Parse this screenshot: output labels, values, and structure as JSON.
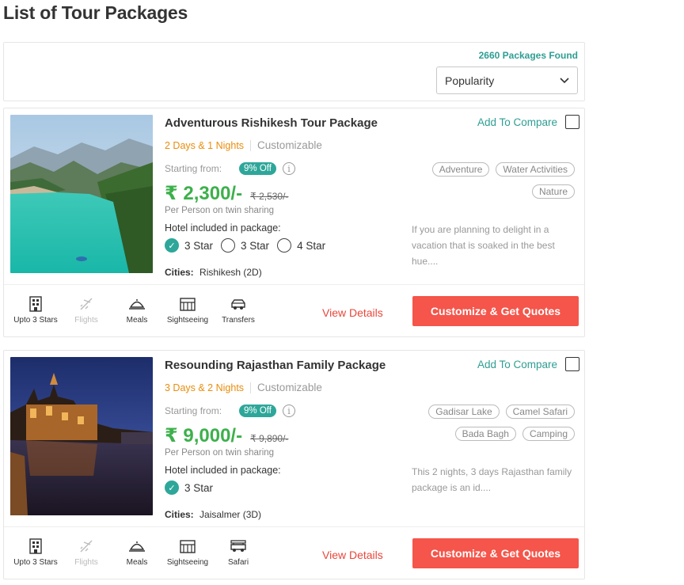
{
  "page": {
    "title": "List of Tour Packages"
  },
  "sortbar": {
    "found": "2660 Packages Found",
    "sort_selected": "Popularity"
  },
  "packages": [
    {
      "title": "Adventurous Rishikesh Tour Package",
      "compare_label": "Add To Compare",
      "duration": "2 Days & 1 Nights",
      "customizable": "Customizable",
      "starting_from": "Starting from:",
      "discount": "9% Off",
      "price": "₹ 2,300/-",
      "old_price": "₹ 2,530/-",
      "per_person": "Per Person on twin sharing",
      "hotel_label": "Hotel included in package:",
      "hotel_options": [
        {
          "label": "3 Star",
          "checked": true
        },
        {
          "label": "3 Star",
          "checked": false
        },
        {
          "label": "4 Star",
          "checked": false
        }
      ],
      "cities_label": "Cities:",
      "cities": "Rishikesh (2D)",
      "tags": [
        "Adventure",
        "Water Activities",
        "Nature"
      ],
      "description": "If you are planning to delight in a vacation that is soaked in the best hue....",
      "features": [
        {
          "label": "Upto 3 Stars",
          "icon": "hotel-icon",
          "enabled": true
        },
        {
          "label": "Flights",
          "icon": "flight-icon",
          "enabled": false
        },
        {
          "label": "Meals",
          "icon": "meal-cloche-icon",
          "enabled": true
        },
        {
          "label": "Sightseeing",
          "icon": "sightseeing-icon",
          "enabled": true
        },
        {
          "label": "Transfers",
          "icon": "car-icon",
          "enabled": true
        }
      ],
      "view_details": "View Details",
      "cta": "Customize & Get Quotes"
    },
    {
      "title": "Resounding Rajasthan Family Package",
      "compare_label": "Add To Compare",
      "duration": "3 Days & 2 Nights",
      "customizable": "Customizable",
      "starting_from": "Starting from:",
      "discount": "9% Off",
      "price": "₹ 9,000/-",
      "old_price": "₹ 9,890/-",
      "per_person": "Per Person on twin sharing",
      "hotel_label": "Hotel included in package:",
      "hotel_options": [
        {
          "label": "3 Star",
          "checked": true
        }
      ],
      "cities_label": "Cities:",
      "cities": "Jaisalmer (3D)",
      "tags": [
        "Gadisar Lake",
        "Camel Safari",
        "Bada Bagh",
        "Camping"
      ],
      "description": "This 2 nights, 3 days Rajasthan family package is an id....",
      "features": [
        {
          "label": "Upto 3 Stars",
          "icon": "hotel-icon",
          "enabled": true
        },
        {
          "label": "Flights",
          "icon": "flight-icon",
          "enabled": false
        },
        {
          "label": "Meals",
          "icon": "meal-cloche-icon",
          "enabled": true
        },
        {
          "label": "Sightseeing",
          "icon": "sightseeing-icon",
          "enabled": true
        },
        {
          "label": "Safari",
          "icon": "jeep-icon",
          "enabled": true
        }
      ],
      "view_details": "View Details",
      "cta": "Customize & Get Quotes"
    }
  ]
}
